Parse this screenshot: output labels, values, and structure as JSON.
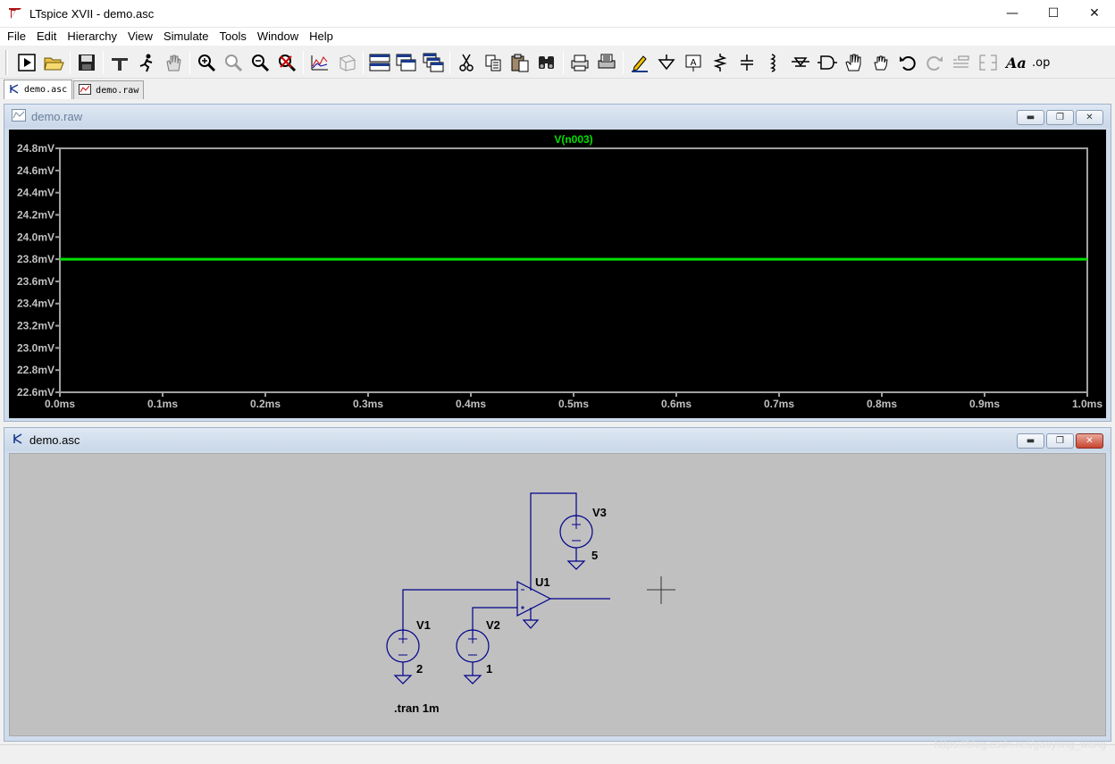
{
  "window": {
    "title": "LTspice XVII - demo.asc",
    "minimize": "—",
    "maximize": "☐",
    "close": "✕"
  },
  "menu": [
    "File",
    "Edit",
    "Hierarchy",
    "View",
    "Simulate",
    "Tools",
    "Window",
    "Help"
  ],
  "toolbar_icons": [
    "run-icon",
    "open-icon",
    "save-icon",
    "control-panel-icon",
    "halt-icon",
    "pan-icon",
    "zoom-in-icon",
    "zoom-area-icon",
    "zoom-out-icon",
    "zoom-cancel-icon",
    "autoscale-icon",
    "tile-icon",
    "tile-horizontal-icon",
    "tile-vertical-icon",
    "cascade-icon",
    "cut-icon",
    "copy-icon",
    "paste-icon",
    "find-icon",
    "print-icon",
    "print-setup-icon",
    "wire-icon",
    "ground-icon",
    "label-net-icon",
    "resistor-icon",
    "capacitor-icon",
    "inductor-icon",
    "diode-icon",
    "component-icon",
    "move-icon",
    "drag-icon",
    "undo-icon",
    "redo-icon",
    "rotate-icon",
    "mirror-icon",
    "text-icon",
    "spice-directive-icon"
  ],
  "tabs": [
    {
      "label": "demo.asc",
      "active": true
    },
    {
      "label": "demo.raw",
      "active": false
    }
  ],
  "plot_window": {
    "title": "demo.raw",
    "trace_label": "V(n003)",
    "trace_color": "#00e000"
  },
  "schematic_window": {
    "title": "demo.asc",
    "components": {
      "v1": {
        "name": "V1",
        "value": "2"
      },
      "v2": {
        "name": "V2",
        "value": "1"
      },
      "v3": {
        "name": "V3",
        "value": "5"
      },
      "u1": {
        "name": "U1"
      }
    },
    "directive": ".tran 1m",
    "wire_color": "#00008b"
  },
  "chart_data": {
    "type": "line",
    "title": "V(n003)",
    "xlabel": "",
    "ylabel": "",
    "x_ticks": [
      "0.0ms",
      "0.1ms",
      "0.2ms",
      "0.3ms",
      "0.4ms",
      "0.5ms",
      "0.6ms",
      "0.7ms",
      "0.8ms",
      "0.9ms",
      "1.0ms"
    ],
    "y_ticks": [
      "24.8mV",
      "24.6mV",
      "24.4mV",
      "24.2mV",
      "24.0mV",
      "23.8mV",
      "23.6mV",
      "23.4mV",
      "23.2mV",
      "23.0mV",
      "22.8mV",
      "22.6mV"
    ],
    "xlim": [
      0,
      1.0
    ],
    "ylim": [
      22.6,
      24.8
    ],
    "series": [
      {
        "name": "V(n003)",
        "x": [
          0,
          1.0
        ],
        "y": [
          23.8,
          23.8
        ]
      }
    ]
  },
  "watermark": "https://blog.csdn.net/gaoyong_wang"
}
